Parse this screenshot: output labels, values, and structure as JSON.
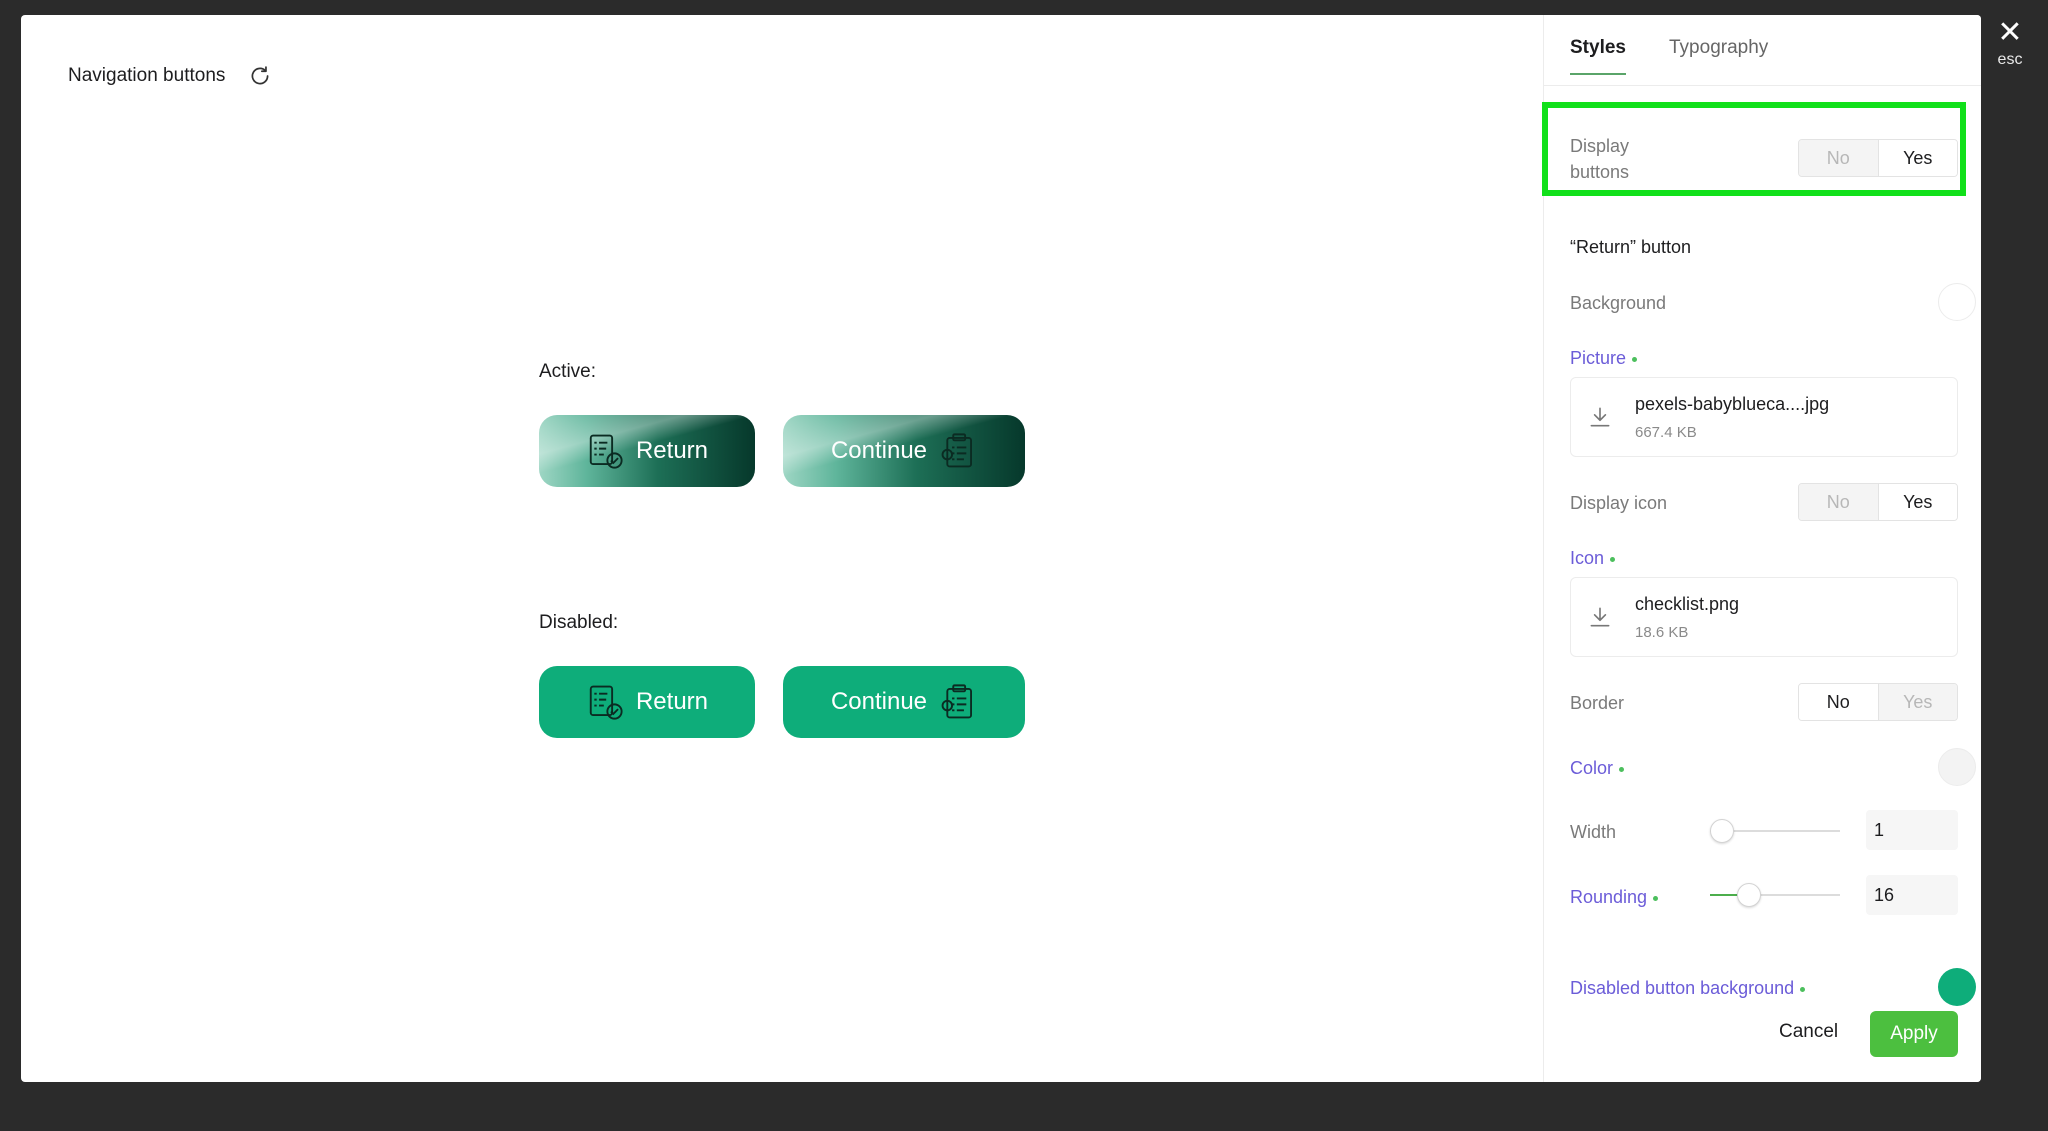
{
  "window": {
    "close_hint": "esc"
  },
  "preview": {
    "title": "Navigation buttons",
    "active_label": "Active:",
    "disabled_label": "Disabled:",
    "return_label": "Return",
    "continue_label": "Continue"
  },
  "panel": {
    "tabs": [
      {
        "label": "Styles"
      },
      {
        "label": "Typography"
      }
    ],
    "display_buttons": {
      "label": "Display buttons",
      "no": "No",
      "yes": "Yes",
      "selected": "Yes"
    },
    "return_section_title": "“Return” button",
    "background_label": "Background",
    "picture": {
      "label": "Picture",
      "file_name": "pexels-babyblueca....jpg",
      "file_size": "667.4 KB"
    },
    "display_icon": {
      "label": "Display icon",
      "no": "No",
      "yes": "Yes",
      "selected": "Yes"
    },
    "icon": {
      "label": "Icon",
      "file_name": "checklist.png",
      "file_size": "18.6 KB"
    },
    "border": {
      "label": "Border",
      "no": "No",
      "yes": "Yes",
      "selected": "No"
    },
    "color_label": "Color",
    "width": {
      "label": "Width",
      "value": "1",
      "slider_fraction": 0.0
    },
    "rounding": {
      "label": "Rounding",
      "value": "16",
      "slider_fraction": 0.25
    },
    "disabled_bg_label": "Disabled button background",
    "cancel_label": "Cancel",
    "apply_label": "Apply"
  },
  "colors": {
    "accent_green": "#4cbf3f",
    "disabled_button": "#0ead7a",
    "highlight": "#11e01a",
    "link_purple": "#6b5cd8"
  }
}
